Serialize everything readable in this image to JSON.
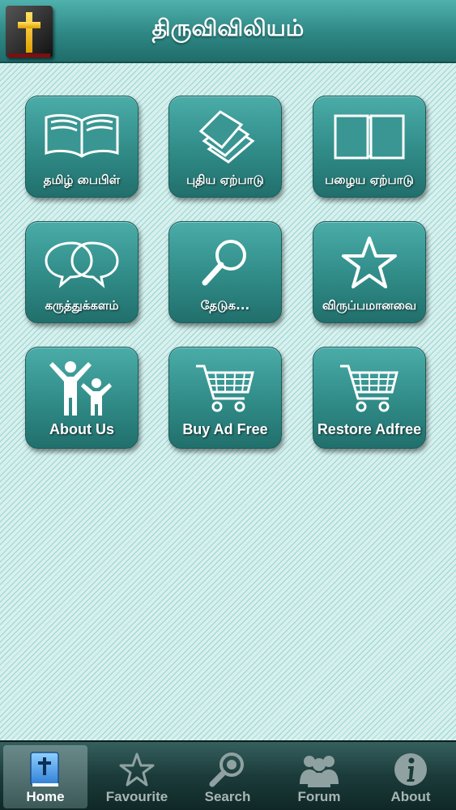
{
  "header": {
    "title": "திருவிவிலியம்"
  },
  "tiles": [
    {
      "label": "தமிழ் பைபிள்",
      "icon": "open-book-icon"
    },
    {
      "label": "புதிய ஏற்பாடு",
      "icon": "pages-icon"
    },
    {
      "label": "பழைய ஏற்பாடு",
      "icon": "book-icon"
    },
    {
      "label": "கருத்துக்களம்",
      "icon": "chat-bubbles-icon"
    },
    {
      "label": "தேடுக...",
      "icon": "magnifier-icon"
    },
    {
      "label": "விருப்பமானவை",
      "icon": "star-icon"
    },
    {
      "label": "About Us",
      "icon": "people-icon"
    },
    {
      "label": "Buy Ad Free",
      "icon": "cart-icon"
    },
    {
      "label": "Restore Adfree",
      "icon": "cart-icon"
    }
  ],
  "tabs": [
    {
      "label": "Home",
      "icon": "bible-icon",
      "active": true
    },
    {
      "label": "Favourite",
      "icon": "star-icon",
      "active": false
    },
    {
      "label": "Search",
      "icon": "magnifier-icon",
      "active": false
    },
    {
      "label": "Forum",
      "icon": "people-icon",
      "active": false
    },
    {
      "label": "About",
      "icon": "info-icon",
      "active": false
    }
  ],
  "colors": {
    "header": "#2e8784",
    "tile": "#2e8884",
    "background": "#d7f0ee",
    "tabbar": "#1b3b3a"
  }
}
